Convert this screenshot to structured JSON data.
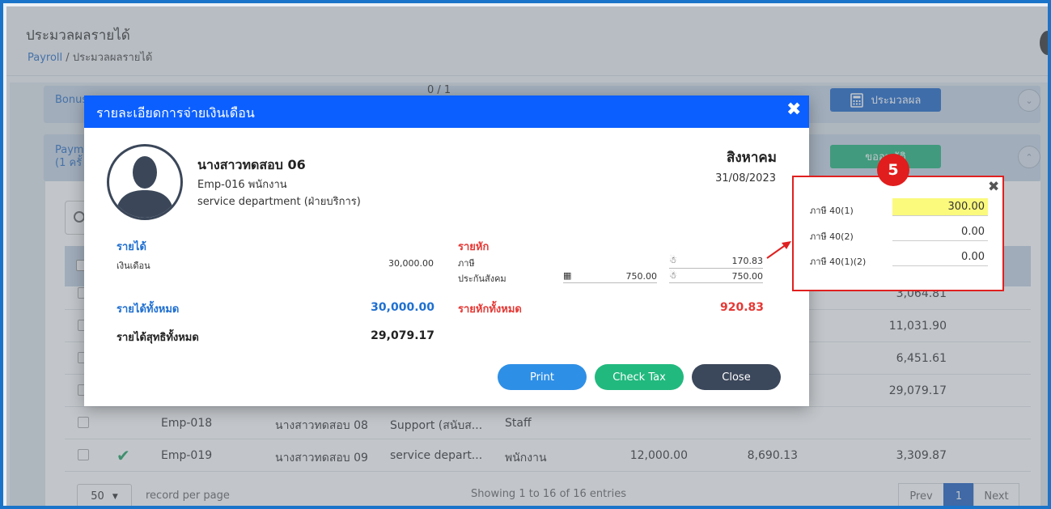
{
  "header": {
    "title": "ประมวลผลรายได้",
    "breadcrumb_root": "Payroll",
    "breadcrumb_sep": "/",
    "breadcrumb_current": "ประมวลผลรายได้"
  },
  "bonus_panel": {
    "title": "Bonus",
    "counter": "0 / 1",
    "button": "ประมวลผล"
  },
  "payment_panel": {
    "title_line1": "Payme",
    "title_line2": "(1 ครั้",
    "button": "ขออนุมัติ"
  },
  "table": {
    "rows": [
      {
        "id": "",
        "name": "",
        "dept": "",
        "pos": "",
        "income": "",
        "deduct": "",
        "net": "3,064.81",
        "status": ""
      },
      {
        "id": "",
        "name": "",
        "dept": "",
        "pos": "",
        "income": "",
        "deduct": "",
        "net": "11,031.90",
        "status": ""
      },
      {
        "id": "",
        "name": "",
        "dept": "",
        "pos": "",
        "income": "",
        "deduct": "",
        "net": "6,451.61",
        "status": ""
      },
      {
        "id": "",
        "name": "",
        "dept": "",
        "pos": "",
        "income": "",
        "deduct": "",
        "net": "29,079.17",
        "status": ""
      },
      {
        "id": "Emp-018",
        "name": "นางสาวทดสอบ 08",
        "dept": "Support (สนับส...",
        "pos": "Staff",
        "income": "",
        "deduct": "",
        "net": "",
        "status": ""
      },
      {
        "id": "Emp-019",
        "name": "นางสาวทดสอบ 09",
        "dept": "service depart...",
        "pos": "พนักงาน",
        "income": "12,000.00",
        "deduct": "8,690.13",
        "net": "3,309.87",
        "status": "approved"
      }
    ]
  },
  "pager": {
    "per_page": "50",
    "per_page_label": "record per page",
    "showing": "Showing 1 to 16 of 16 entries",
    "prev": "Prev",
    "current": "1",
    "next": "Next"
  },
  "modal": {
    "title": "รายละเอียดการจ่ายเงินเดือน",
    "employee_name": "นางสาวทดสอบ 06",
    "employee_id_line": "Emp-016   พนักงาน",
    "department": "service department (ฝ่ายบริการ)",
    "month": "สิงหาคม",
    "date": "31/08/2023",
    "income_heading": "รายได้",
    "income_items": [
      {
        "label": "เงินเดือน",
        "value": "30,000.00"
      }
    ],
    "deduct_heading": "รายหัก",
    "deduct_items": [
      {
        "label": "ภาษี",
        "value": "170.83"
      },
      {
        "label": "ประกันสังคม",
        "employer_value": "750.00",
        "value": "750.00"
      }
    ],
    "total_income_label": "รายได้ทั้งหมด",
    "total_income": "30,000.00",
    "total_deduct_label": "รายหักทั้งหมด",
    "total_deduct": "920.83",
    "net_label": "รายได้สุทธิทั้งหมด",
    "net_value": "29,079.17",
    "buttons": {
      "print": "Print",
      "check_tax": "Check Tax",
      "close": "Close"
    }
  },
  "tax_popup": {
    "step": "5",
    "items": [
      {
        "label": "ภาษี 40(1)",
        "value": "300.00"
      },
      {
        "label": "ภาษี 40(2)",
        "value": "0.00"
      },
      {
        "label": "ภาษี 40(1)(2)",
        "value": "0.00"
      }
    ]
  },
  "colors": {
    "frame_border": "#1a74c9",
    "modal_header": "#0b5fff",
    "income_blue": "#1f6fd1",
    "deduct_red": "#e53935",
    "approve_green": "#21b47a",
    "highlight_yellow": "#fbfa7c",
    "callout_red": "#e02020"
  }
}
